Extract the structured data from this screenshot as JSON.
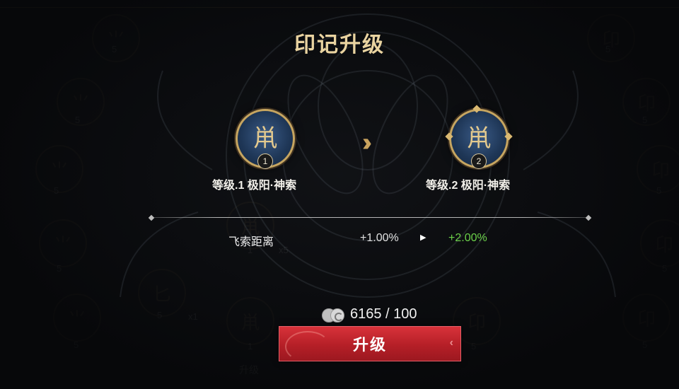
{
  "dialog": {
    "title": "印记升级",
    "current": {
      "glyph": "鼡",
      "level_badge": "1",
      "label": "等级.1   极阳·神索"
    },
    "next": {
      "glyph": "鼡",
      "level_badge": "2",
      "label": "等级.2   极阳·神索"
    },
    "transition_icon": "double-chevron-right-icon",
    "stat": {
      "name": "飞索距离",
      "from": "+1.00%",
      "to": "+2.00%",
      "to_color": "#6cd24a"
    },
    "cost": {
      "currency_icon": "spirit-coin-icon",
      "text": "6165 / 100"
    },
    "upgrade_button": "升级"
  },
  "background": {
    "rune_counts": [
      "5",
      "5",
      "5",
      "5",
      "5",
      "5",
      "5",
      "5",
      "5",
      "5",
      "5",
      "5",
      "1",
      "5",
      "5",
      "5",
      "1",
      "5",
      "5"
    ],
    "multipliers": [
      "x5",
      "x1"
    ],
    "button_label": "升级"
  },
  "colors": {
    "title": "#e9d3a0",
    "button": "#c9282f",
    "gold": "#c6a560"
  }
}
